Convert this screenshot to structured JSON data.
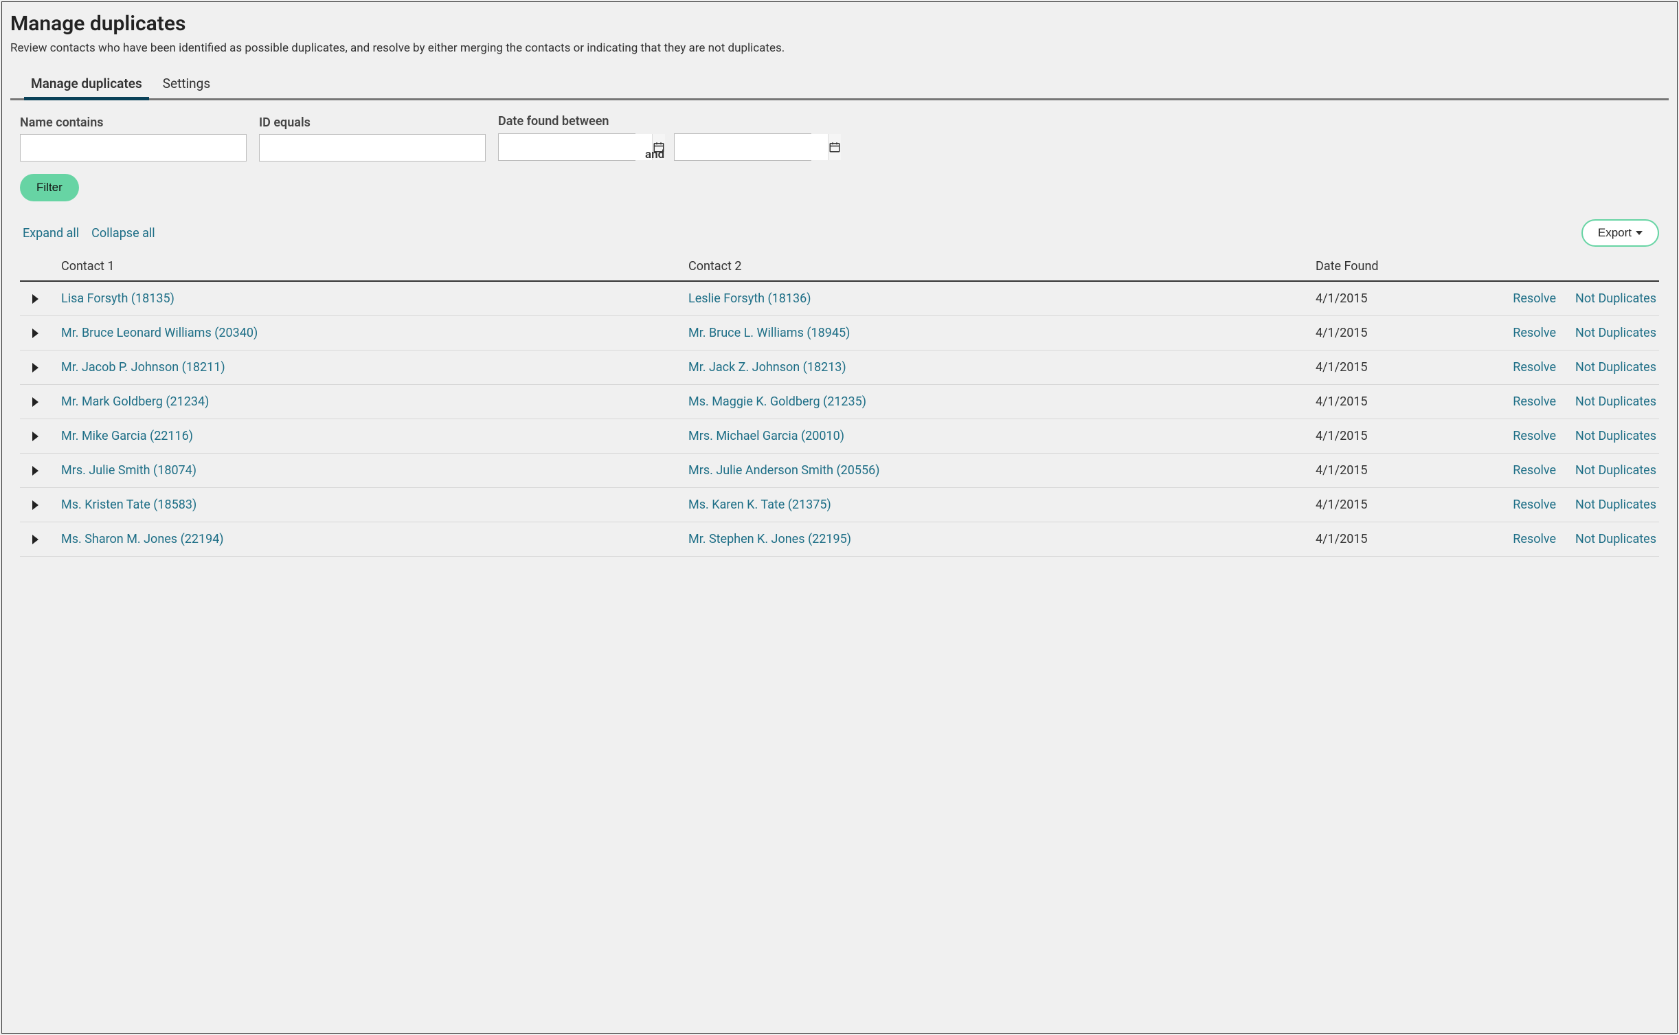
{
  "header": {
    "title": "Manage duplicates",
    "subtitle": "Review contacts who have been identified as possible duplicates, and resolve by either merging the contacts or indicating that they are not duplicates."
  },
  "tabs": [
    {
      "label": "Manage duplicates",
      "active": true
    },
    {
      "label": "Settings",
      "active": false
    }
  ],
  "filters": {
    "name_label": "Name contains",
    "name_value": "",
    "id_label": "ID equals",
    "id_value": "",
    "date_label": "Date found between",
    "date_from_value": "",
    "and_label": "and",
    "date_to_value": "",
    "button_label": "Filter"
  },
  "toolbar": {
    "expand_all": "Expand all",
    "collapse_all": "Collapse all",
    "export_label": "Export"
  },
  "columns": {
    "contact1": "Contact 1",
    "contact2": "Contact 2",
    "date_found": "Date Found"
  },
  "actions": {
    "resolve": "Resolve",
    "not_duplicates": "Not Duplicates"
  },
  "rows": [
    {
      "contact1": "Lisa Forsyth (18135)",
      "contact2": "Leslie Forsyth (18136)",
      "date": "4/1/2015"
    },
    {
      "contact1": "Mr. Bruce Leonard Williams (20340)",
      "contact2": "Mr. Bruce L. Williams (18945)",
      "date": "4/1/2015"
    },
    {
      "contact1": "Mr. Jacob P. Johnson (18211)",
      "contact2": "Mr. Jack Z. Johnson (18213)",
      "date": "4/1/2015"
    },
    {
      "contact1": "Mr. Mark Goldberg (21234)",
      "contact2": "Ms. Maggie K. Goldberg (21235)",
      "date": "4/1/2015"
    },
    {
      "contact1": "Mr. Mike Garcia (22116)",
      "contact2": "Mrs. Michael Garcia (20010)",
      "date": "4/1/2015"
    },
    {
      "contact1": "Mrs. Julie Smith (18074)",
      "contact2": "Mrs. Julie Anderson Smith (20556)",
      "date": "4/1/2015"
    },
    {
      "contact1": "Ms. Kristen Tate (18583)",
      "contact2": "Ms. Karen K. Tate (21375)",
      "date": "4/1/2015"
    },
    {
      "contact1": "Ms. Sharon M. Jones (22194)",
      "contact2": "Mr. Stephen K. Jones (22195)",
      "date": "4/1/2015"
    }
  ]
}
